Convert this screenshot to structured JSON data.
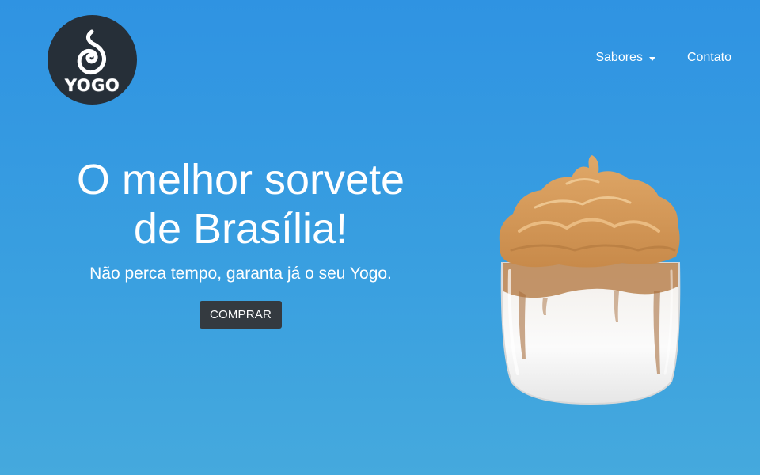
{
  "brand": {
    "logo_text": "YOGO"
  },
  "nav": {
    "items": [
      {
        "label": "Sabores",
        "dropdown": true
      },
      {
        "label": "Contato",
        "dropdown": false
      }
    ]
  },
  "hero": {
    "title_line1": "O melhor sorvete",
    "title_line2": "de Brasília!",
    "subtitle": "Não perca tempo, garanta já o seu Yogo.",
    "button_label": "COMPRAR"
  },
  "colors": {
    "background": "#3399e0",
    "logo_bg": "#262f38",
    "button_bg": "#343a40",
    "text": "#ffffff"
  },
  "icons": {
    "logo": "swirl-icon",
    "dropdown": "caret-down-icon",
    "product": "dalgona-coffee-glass-image"
  }
}
